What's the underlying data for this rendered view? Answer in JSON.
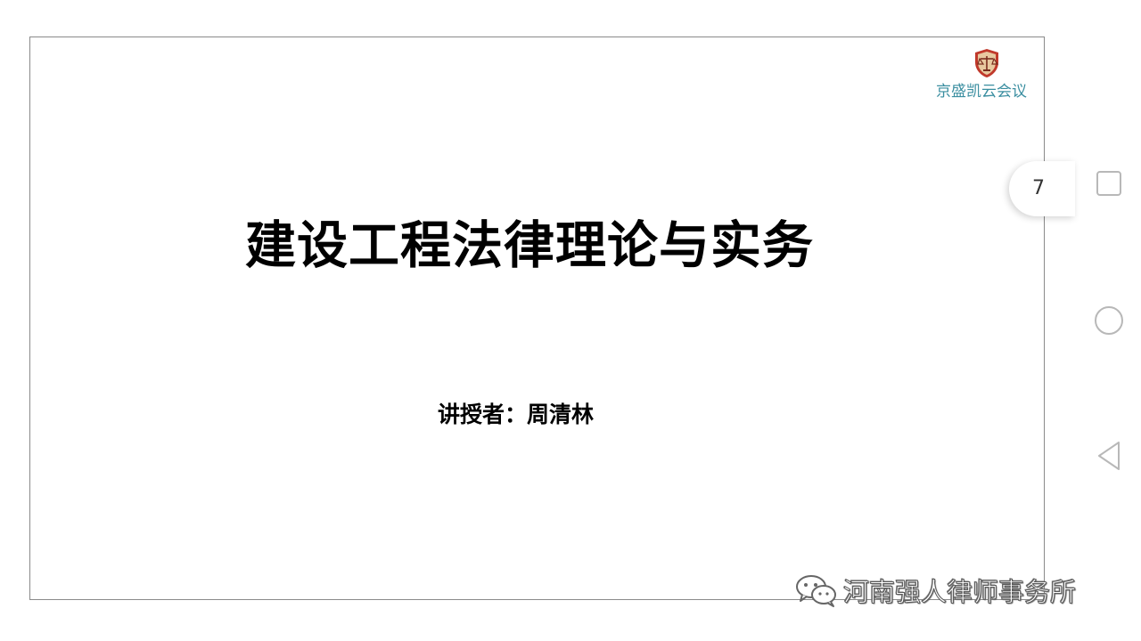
{
  "slide": {
    "logo_text": "京盛凯云会议",
    "title": "建设工程法律理论与实务",
    "presenter": "讲授者：周清林"
  },
  "viewer": {
    "page_number": "7"
  },
  "navigation": {
    "recent_icon": "square-icon",
    "home_icon": "circle-icon",
    "back_icon": "triangle-back-icon"
  },
  "watermark": {
    "text": "河南强人律师事务所",
    "icon": "wechat-icon"
  },
  "colors": {
    "logo_teal": "#3a8ea0",
    "logo_red": "#c0392b",
    "nav_gray": "#b8b8b8"
  }
}
